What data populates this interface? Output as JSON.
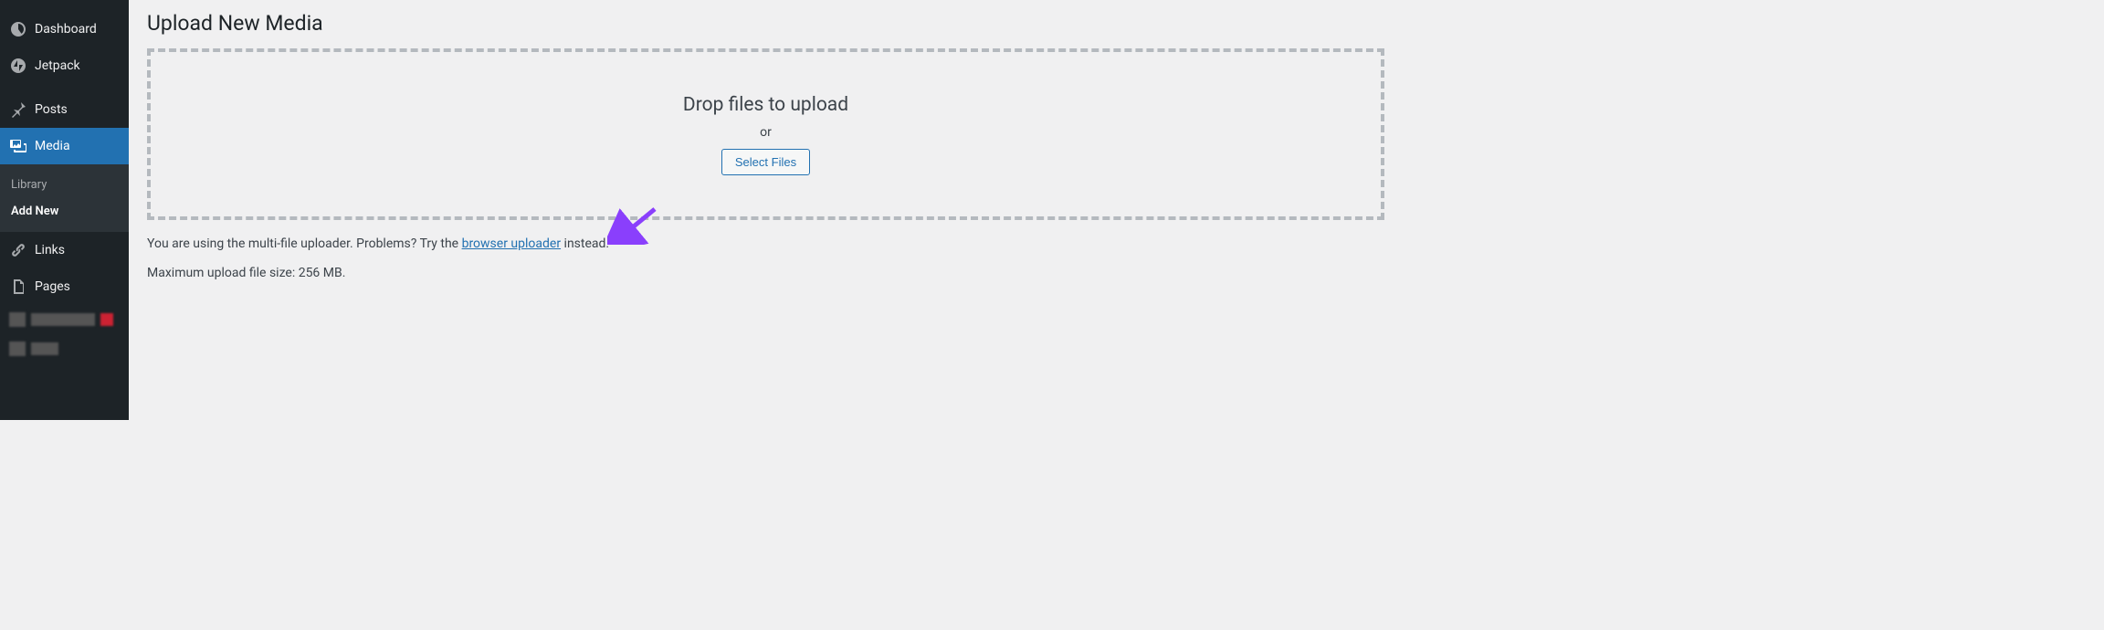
{
  "sidebar": {
    "items": [
      {
        "label": "Dashboard"
      },
      {
        "label": "Jetpack"
      },
      {
        "label": "Posts"
      },
      {
        "label": "Media"
      },
      {
        "label": "Links"
      },
      {
        "label": "Pages"
      }
    ],
    "submenu": [
      {
        "label": "Library"
      },
      {
        "label": "Add New"
      }
    ]
  },
  "main": {
    "title": "Upload New Media",
    "dropzone": {
      "heading": "Drop files to upload",
      "or": "or",
      "button": "Select Files"
    },
    "info": {
      "before": "You are using the multi-file uploader. Problems? Try the ",
      "link": "browser uploader",
      "after": " instead."
    },
    "max_size": "Maximum upload file size: 256 MB."
  }
}
